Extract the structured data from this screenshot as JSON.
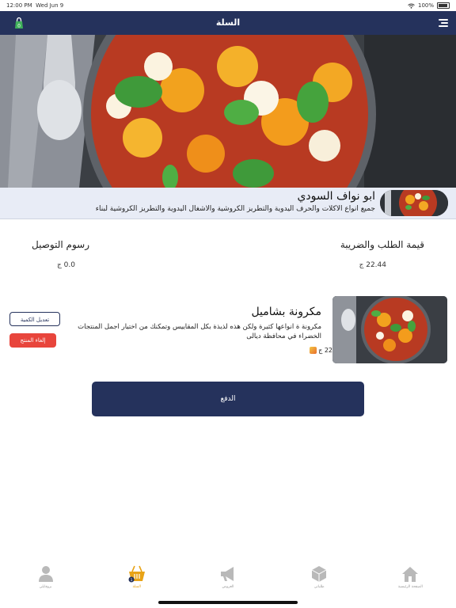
{
  "status": {
    "time": "12:00 PM",
    "date": "Wed Jun 9",
    "battery": "100%"
  },
  "header": {
    "title": "السلة"
  },
  "seller": {
    "name": "ابو نواف السودي",
    "description": "جميع انواع الاكلات والحرف اليدوية والتطريز الكروشية والاشغال اليدوية والتطريز الكروشية لبناء"
  },
  "summary": {
    "order_total_label": "قيمة الطلب والضريبة",
    "order_total_value": "22.44 ج",
    "delivery_label": "رسوم التوصيل",
    "delivery_value": "0.0 ج"
  },
  "product": {
    "name": "مكرونة بشاميل",
    "description": "مكرونة ة انواعها كثيرة ولكن هذه لذيذة بكل المقاييس وتمكنك من اختيار اجمل المنتجات الخضراء في محافظة ديالى",
    "price": "22 ج",
    "edit_label": "تعديل الكمية",
    "cancel_label": "إلغاء المنتج"
  },
  "pay_button": {
    "label": "الدفع"
  },
  "cart_badge": "0",
  "tabs": [
    {
      "label": "الصفحة الرئيسية",
      "icon": "home-icon",
      "active": false
    },
    {
      "label": "طلباتي",
      "icon": "orders-icon",
      "active": false
    },
    {
      "label": "العروض",
      "icon": "megaphone-icon",
      "active": false
    },
    {
      "label": "السلة",
      "icon": "basket-icon",
      "active": true,
      "badge": "1"
    },
    {
      "label": "بروفايلي",
      "icon": "user-icon",
      "active": false
    }
  ],
  "colors": {
    "primary": "#25325c",
    "danger": "#e8453c",
    "accent": "#e8a317",
    "inactive": "#9a9a9a"
  }
}
